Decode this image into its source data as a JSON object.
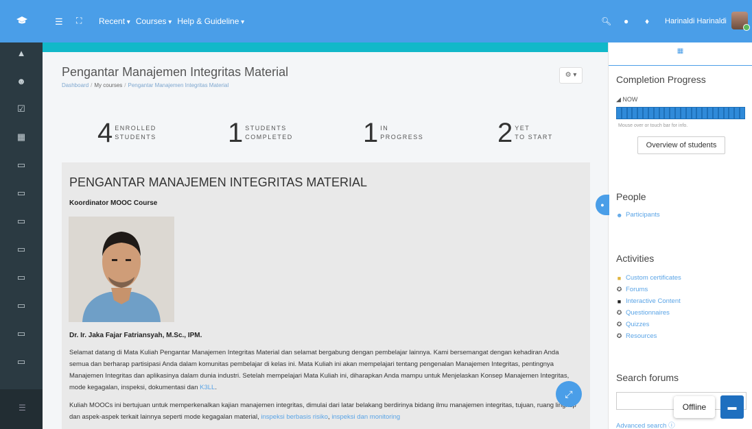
{
  "colors": {
    "navbar": "#4a9ee8",
    "sidebar": "#2b3a42",
    "accent_bar": "#11b8c9",
    "link": "#5aa4e6",
    "progress": "#1d6fb8"
  },
  "navbar": {
    "logo_icon": "graduation-cap-icon",
    "links": [
      "Recent",
      "Courses",
      "Help & Guideline"
    ],
    "user_name": "Harinaldi Harinaldi"
  },
  "sidebar": {
    "icons": [
      "graduation-cap-icon",
      "users-icon",
      "check-square-icon",
      "calendar-icon",
      "folder-icon",
      "folder-icon",
      "folder-icon",
      "folder-icon",
      "folder-icon",
      "folder-icon",
      "folder-icon",
      "folder-icon"
    ]
  },
  "page": {
    "title": "Pengantar Manajemen Integritas Material",
    "breadcrumb": [
      "Dashboard",
      "My courses",
      "Pengantar Manajemen Integritas Material"
    ],
    "settings_icon": "gear-icon"
  },
  "stats": [
    {
      "num": "4",
      "line1": "ENROLLED",
      "line2": "STUDENTS"
    },
    {
      "num": "1",
      "line1": "STUDENTS",
      "line2": "COMPLETED"
    },
    {
      "num": "1",
      "line1": "IN",
      "line2": "PROGRESS"
    },
    {
      "num": "2",
      "line1": "YET",
      "line2": "TO START"
    }
  ],
  "content": {
    "heading": "PENGANTAR MANAJEMEN INTEGRITAS MATERIAL",
    "coordinator_label": "Koordinator MOOC Course",
    "coordinator_name": "Dr. Ir. Jaka Fajar Fatriansyah, M.Sc., IPM.",
    "para1": "Selamat datang di Mata Kuliah Pengantar Manajemen Integritas Material dan selamat bergabung dengan pembelajar lainnya. Kami bersemangat dengan kehadiran Anda semua dan berharap partisipasi Anda dalam komunitas pembelajar di kelas ini. Mata Kuliah ini akan mempelajari tentang pengenalan Manajemen Integritas, pentingnya Manajemen Integritas dan aplikasinya dalam dunia industri. Setelah mempelajari Mata Kuliah ini, diharapkan Anda mampu untuk Menjelaskan Konsep Manajemen Integritas, mode kegagalan, inspeksi, dokumentasi dan",
    "para1_link": "K3LL",
    "para1_end": ".",
    "para2": "Kuliah MOOCs ini bertujuan untuk memperkenalkan kajian manajemen integritas, dimulai dari latar belakang berdirinya bidang ilmu manajemen integritas, tujuan, ruang lingkup dan aspek-aspek terkait lainnya seperti mode kegagalan material,",
    "para2_link1": "inspeksi berbasis risiko",
    "para2_sep": ",",
    "para2_link2": "inspeksi dan monitoring"
  },
  "right": {
    "completion_title": "Completion Progress",
    "now_label": "NOW",
    "progress_fraction": 1.0,
    "hint": "Mouse over or touch bar for info.",
    "overview_button": "Overview of students",
    "people_title": "People",
    "participants_link": "Participants",
    "activities_title": "Activities",
    "activities": [
      {
        "icon": "certificate-icon",
        "label": "Custom certificates"
      },
      {
        "icon": "forum-icon",
        "label": "Forums"
      },
      {
        "icon": "h5p-icon",
        "label": "Interactive Content"
      },
      {
        "icon": "questionnaire-icon",
        "label": "Questionnaires"
      },
      {
        "icon": "quiz-icon",
        "label": "Quizzes"
      },
      {
        "icon": "resource-icon",
        "label": "Resources"
      }
    ],
    "search_title": "Search forums",
    "advanced_search": "Advanced search"
  },
  "chat": {
    "status": "Offline"
  }
}
